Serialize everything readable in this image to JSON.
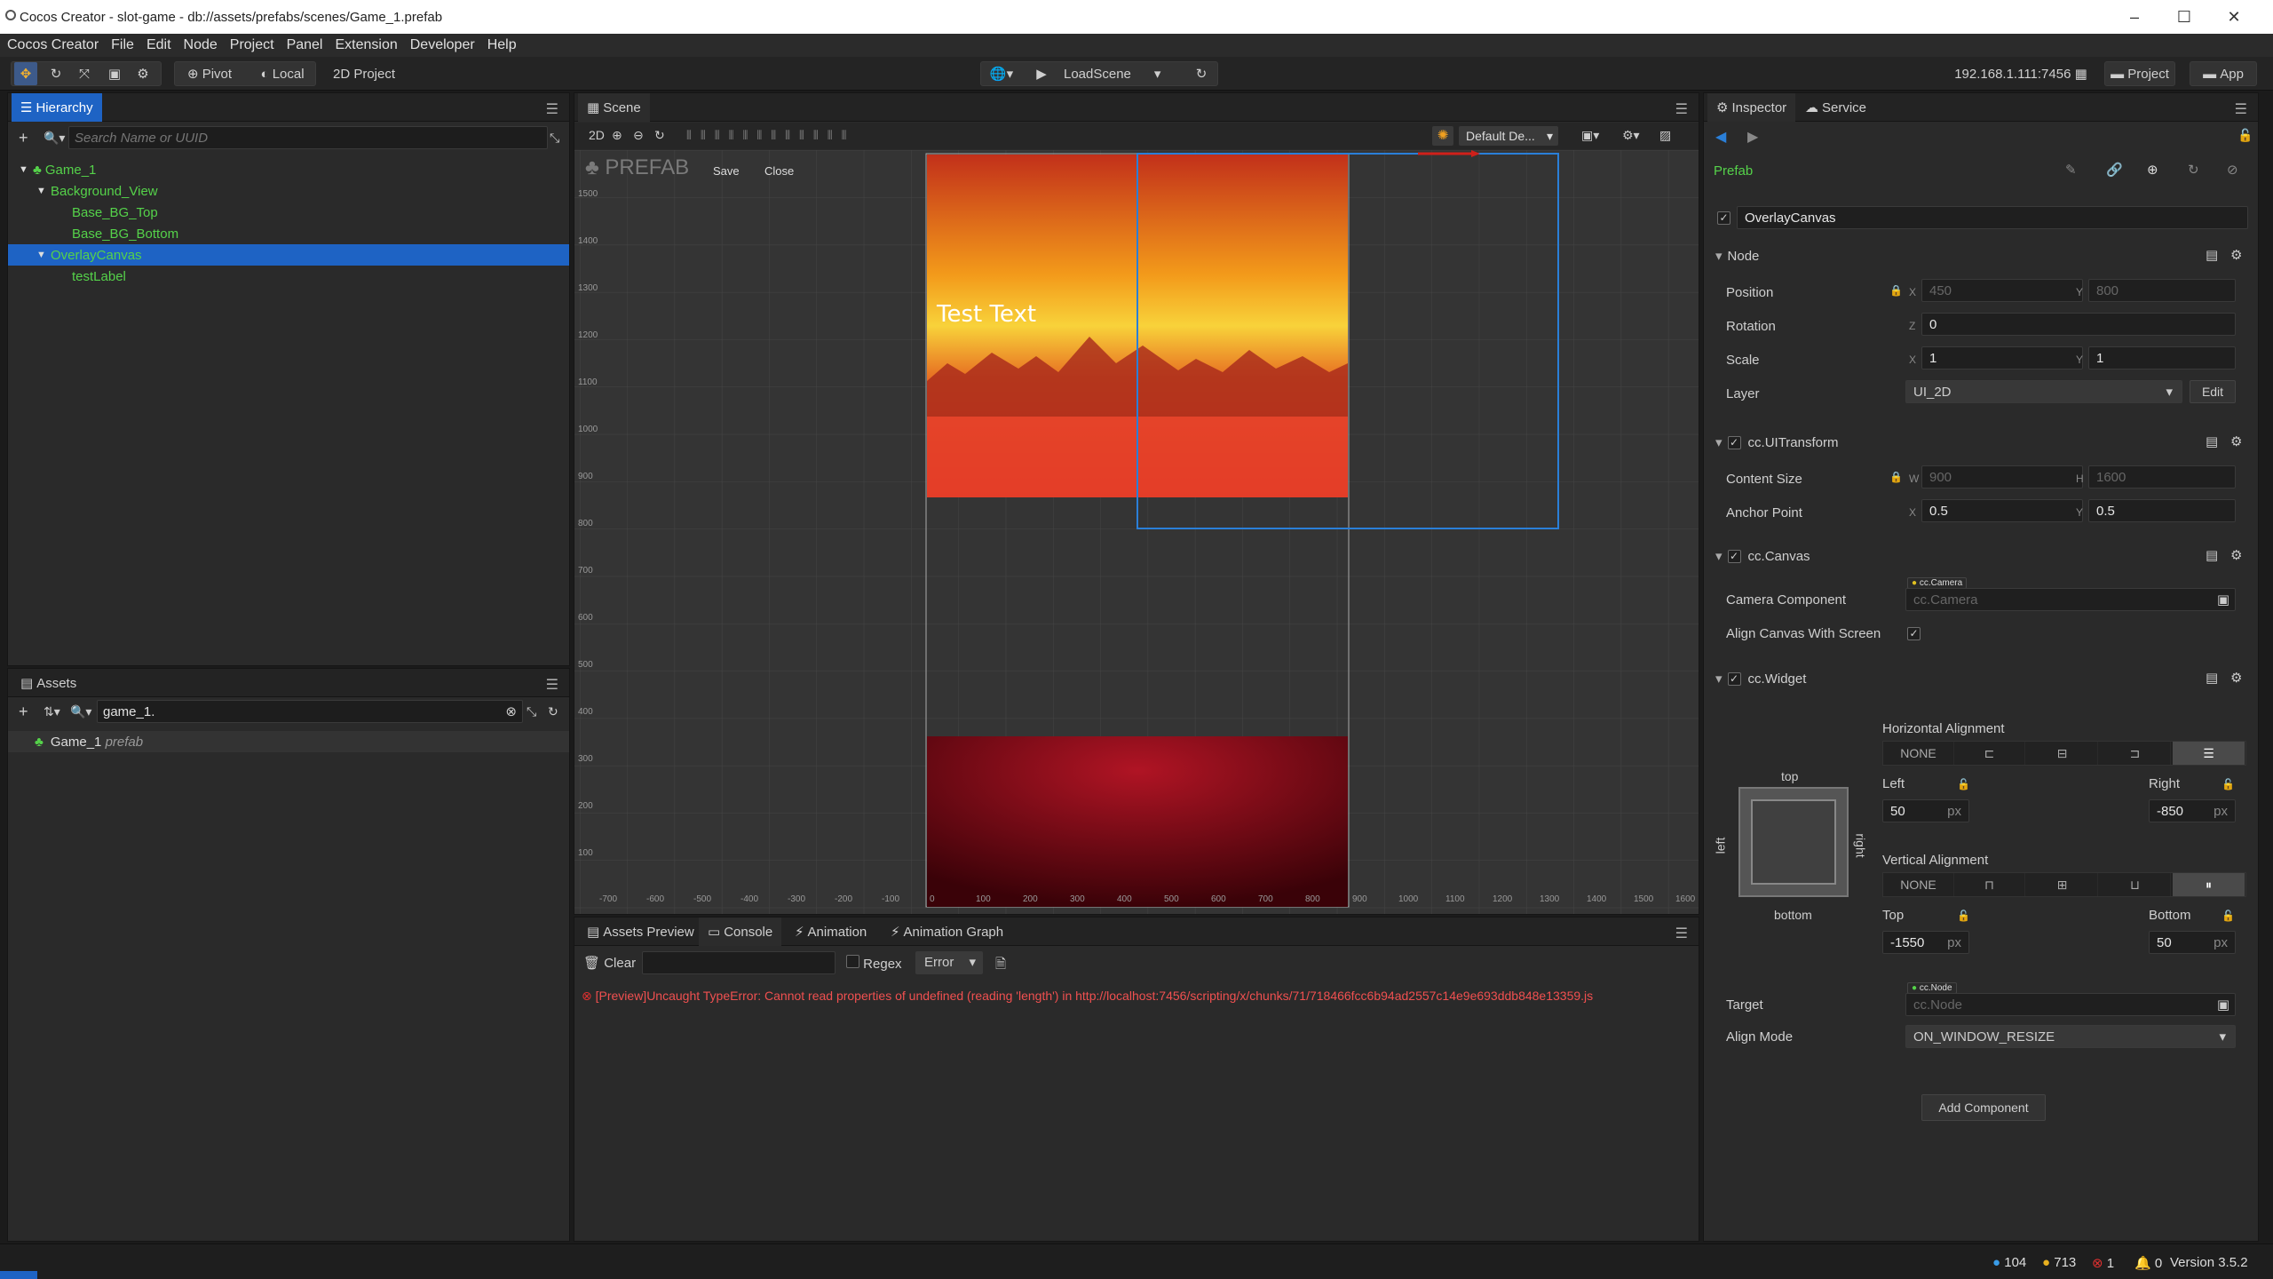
{
  "window": {
    "title": "Cocos Creator - slot-game - db://assets/prefabs/scenes/Game_1.prefab",
    "minimize": "–",
    "maximize": "☐",
    "close": "✕"
  },
  "menu": [
    "Cocos Creator",
    "File",
    "Edit",
    "Node",
    "Project",
    "Panel",
    "Extension",
    "Developer",
    "Help"
  ],
  "toolbar": {
    "pivot": "Pivot",
    "local": "Local",
    "project_type": "2D Project",
    "load_scene": "LoadScene",
    "ip": "192.168.1.111:7456",
    "project_btn": "Project",
    "app_btn": "App"
  },
  "hierarchy": {
    "tab": "Hierarchy",
    "search_placeholder": "Search Name or UUID",
    "items": [
      {
        "label": "Game_1"
      },
      {
        "label": "Background_View"
      },
      {
        "label": "Base_BG_Top"
      },
      {
        "label": "Base_BG_Bottom"
      },
      {
        "label": "OverlayCanvas"
      },
      {
        "label": "testLabel"
      }
    ]
  },
  "assets": {
    "tab": "Assets",
    "search_value": "game_1.",
    "items": [
      {
        "name": "Game_1",
        "type": "prefab"
      }
    ]
  },
  "scene": {
    "tab": "Scene",
    "mode_2d": "2D",
    "prefab_label": "PREFAB",
    "save": "Save",
    "close": "Close",
    "default_dev": "Default De...",
    "test_text": "Test Text",
    "y_ticks": [
      "1500",
      "1400",
      "1300",
      "1200",
      "1100",
      "1000",
      "900",
      "800",
      "700",
      "600",
      "500",
      "400",
      "300",
      "200",
      "100"
    ],
    "x_ticks": [
      "-700",
      "-600",
      "-500",
      "-400",
      "-300",
      "-200",
      "-100",
      "0",
      "100",
      "200",
      "300",
      "400",
      "500",
      "600",
      "700",
      "800",
      "900",
      "1000",
      "1100",
      "1200",
      "1300",
      "1400",
      "1500",
      "1600"
    ]
  },
  "console": {
    "tabs": [
      "Assets Preview",
      "Console",
      "Animation",
      "Animation Graph"
    ],
    "clear": "Clear",
    "regex": "Regex",
    "level": "Error",
    "error": "[Preview]Uncaught TypeError: Cannot read properties of undefined (reading 'length') in http://localhost:7456/scripting/x/chunks/71/718466fcc6b94ad2557c14e9e693ddb848e13359.js"
  },
  "inspector": {
    "tabs": [
      "Inspector",
      "Service"
    ],
    "prefab_label": "Prefab",
    "node_name": "OverlayCanvas",
    "node_section": "Node",
    "position_label": "Position",
    "position": {
      "x": "450",
      "y": "800"
    },
    "rotation_label": "Rotation",
    "rotation_z": "0",
    "scale_label": "Scale",
    "scale": {
      "x": "1",
      "y": "1"
    },
    "layer_label": "Layer",
    "layer_value": "UI_2D",
    "edit": "Edit",
    "uitransform": "cc.UITransform",
    "content_size_label": "Content Size",
    "content_size": {
      "w": "900",
      "h": "1600"
    },
    "anchor_label": "Anchor Point",
    "anchor": {
      "x": "0.5",
      "y": "0.5"
    },
    "canvas": "cc.Canvas",
    "camera_label": "Camera Component",
    "camera_tag": "cc.Camera",
    "camera_placeholder": "cc.Camera",
    "align_canvas_label": "Align Canvas With Screen",
    "widget": "cc.Widget",
    "h_align_label": "Horizontal Alignment",
    "v_align_label": "Vertical Alignment",
    "none": "NONE",
    "top": "top",
    "bottom": "bottom",
    "left": "left",
    "right": "right",
    "left_label": "Left",
    "left_value": "50",
    "right_label": "Right",
    "right_value": "-850",
    "top_label": "Top",
    "top_value": "-1550",
    "bottom_label": "Bottom",
    "bottom_value": "50",
    "px": "px",
    "target_label": "Target",
    "target_tag": "cc.Node",
    "target_placeholder": "cc.Node",
    "align_mode_label": "Align Mode",
    "align_mode": "ON_WINDOW_RESIZE",
    "add_component": "Add Component"
  },
  "status": {
    "info": "104",
    "warn": "713",
    "error": "1",
    "notify": "0",
    "version": "Version 3.5.2"
  }
}
